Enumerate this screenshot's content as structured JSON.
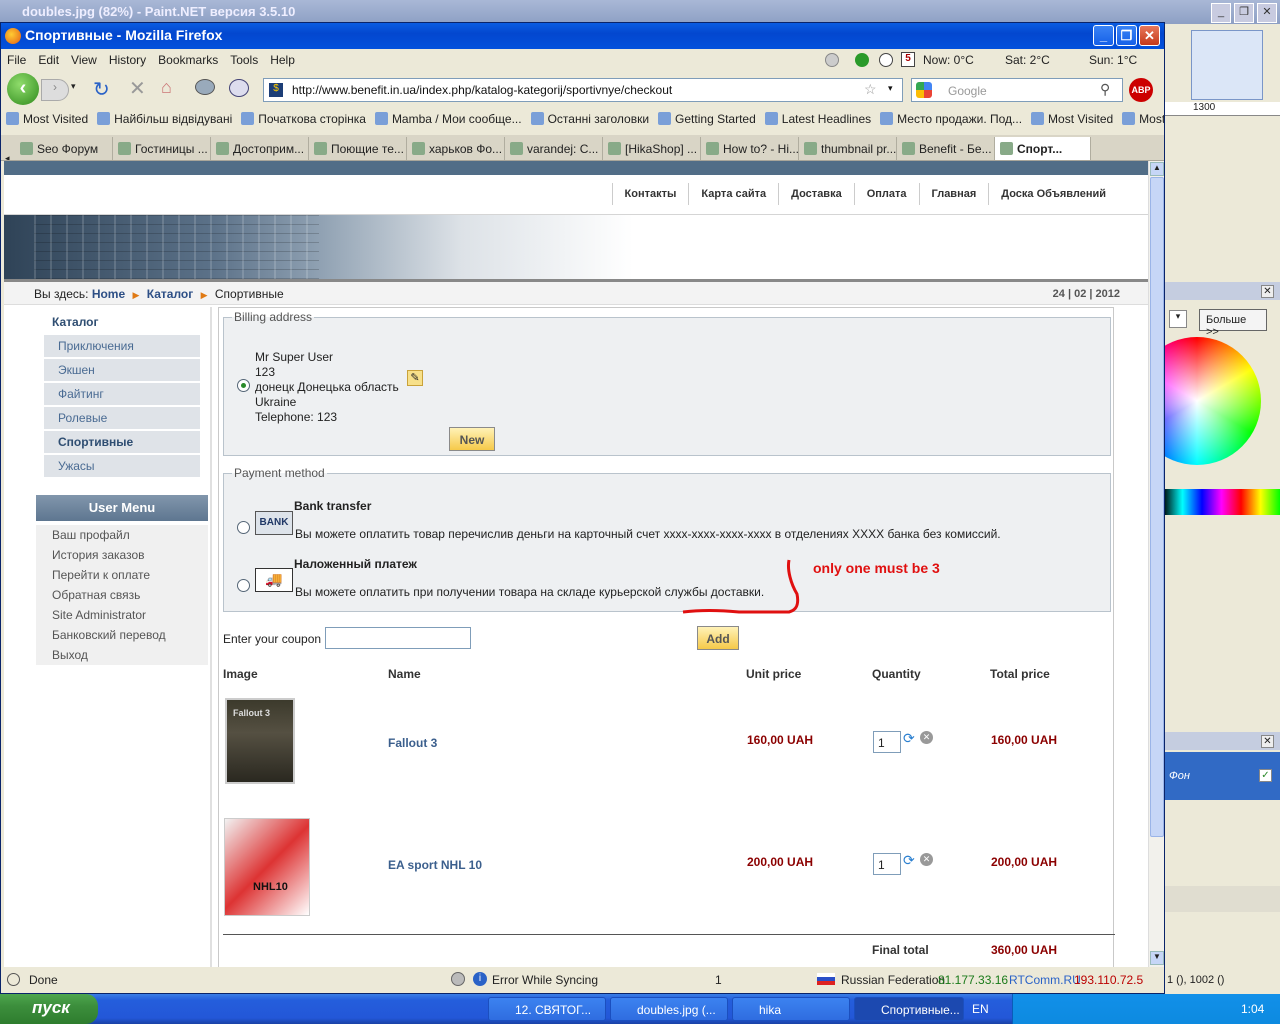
{
  "paintnet": {
    "title": "doubles.jpg (82%) - Paint.NET версия 3.5.10",
    "ruler": "1300",
    "more_btn": "Больше >>",
    "layer_name": "Фон",
    "coords": "1 (), 1002 ()"
  },
  "firefox": {
    "title": "Спортивные - Mozilla Firefox",
    "menu": [
      "File",
      "Edit",
      "View",
      "History",
      "Bookmarks",
      "Tools",
      "Help"
    ],
    "url": "http://www.benefit.in.ua/index.php/katalog-kategorij/sportivnye/checkout",
    "search_placeholder": "Google",
    "weather": {
      "now": "Now: 0°C",
      "sat": "Sat: 2°C",
      "sun": "Sun: 1°C",
      "date_icon": "5"
    },
    "bookmarks": [
      "Most Visited",
      "Найбільш відвідувані",
      "Початкова сторінка",
      "Mamba / Мои сообще...",
      "Останні заголовки",
      "Getting Started",
      "Latest Headlines",
      "Место продажи. Под...",
      "Most Visited",
      "Most Visited"
    ],
    "tabs": [
      "Seo Форум",
      "Гостиницы ...",
      "Достоприм...",
      "Поющие те...",
      "харьков Фо...",
      "varandej: C...",
      "[HikaShop] ...",
      "How to? - Hi...",
      "thumbnail pr...",
      "Benefit - Бе...",
      "Спорт..."
    ],
    "status": {
      "done": "Done",
      "sync": "Error While Syncing",
      "count": "1",
      "country": "Russian Federation",
      "ip1": "81.177.33.16",
      "isp": "RTComm.RU",
      "ip2": "193.110.72.5"
    }
  },
  "site": {
    "topnav": [
      "Контакты",
      "Карта сайта",
      "Доставка",
      "Оплата",
      "Главная",
      "Доска Объявлений"
    ],
    "breadcrumb": {
      "prefix": "Вы здесь:",
      "home": "Home",
      "catalog": "Каталог",
      "current": "Спортивные",
      "date": "24 | 02 | 2012"
    },
    "catalog": {
      "title": "Каталог",
      "items": [
        "Приключения",
        "Экшен",
        "Файтинг",
        "Ролевые",
        "Спортивные",
        "Ужасы"
      ]
    },
    "user_menu": {
      "title": "User Menu",
      "items": [
        "Ваш профайл",
        "История заказов",
        "Перейти к оплате",
        "Обратная связь",
        "Site Administrator",
        "Банковский перевод",
        "Выход"
      ]
    }
  },
  "checkout": {
    "billing": {
      "legend": "Billing address",
      "name": "Mr Super User",
      "line2": "123",
      "city": "донецк Донецька область",
      "country": "Ukraine",
      "phone": "Telephone: 123",
      "new_btn": "New"
    },
    "payment": {
      "legend": "Payment method",
      "methods": [
        {
          "logo": "BANK",
          "title": "Bank transfer",
          "desc": "Вы можете оплатить товар перечислив деньги на карточный счет xxxx-xxxx-xxxx-xxxx в отделениях XXXX банка без комиссий."
        },
        {
          "title": "Наложенный платеж",
          "desc": "Вы можете оплатить при получении товара на складе курьерской службы доставки."
        }
      ]
    },
    "annotation": "only one must be 3",
    "coupon": {
      "label": "Enter your coupon",
      "value": "",
      "add_btn": "Add"
    },
    "columns": [
      "Image",
      "Name",
      "Unit price",
      "Quantity",
      "Total price"
    ],
    "items": [
      {
        "name": "Fallout 3",
        "unit": "160,00 UAH",
        "qty": "1",
        "total": "160,00 UAH",
        "cover": "Fallout 3"
      },
      {
        "name": "EA sport NHL 10",
        "unit": "200,00 UAH",
        "qty": "1",
        "total": "200,00 UAH",
        "cover": "NHL10"
      }
    ],
    "final_label": "Final total",
    "final_value": "360,00 UAH"
  },
  "taskbar": {
    "start": "пуск",
    "buttons": [
      "12. СВЯТОГ...",
      "doubles.jpg (...",
      "hika",
      "Спортивные..."
    ],
    "lang": "EN",
    "time": "1:04"
  }
}
